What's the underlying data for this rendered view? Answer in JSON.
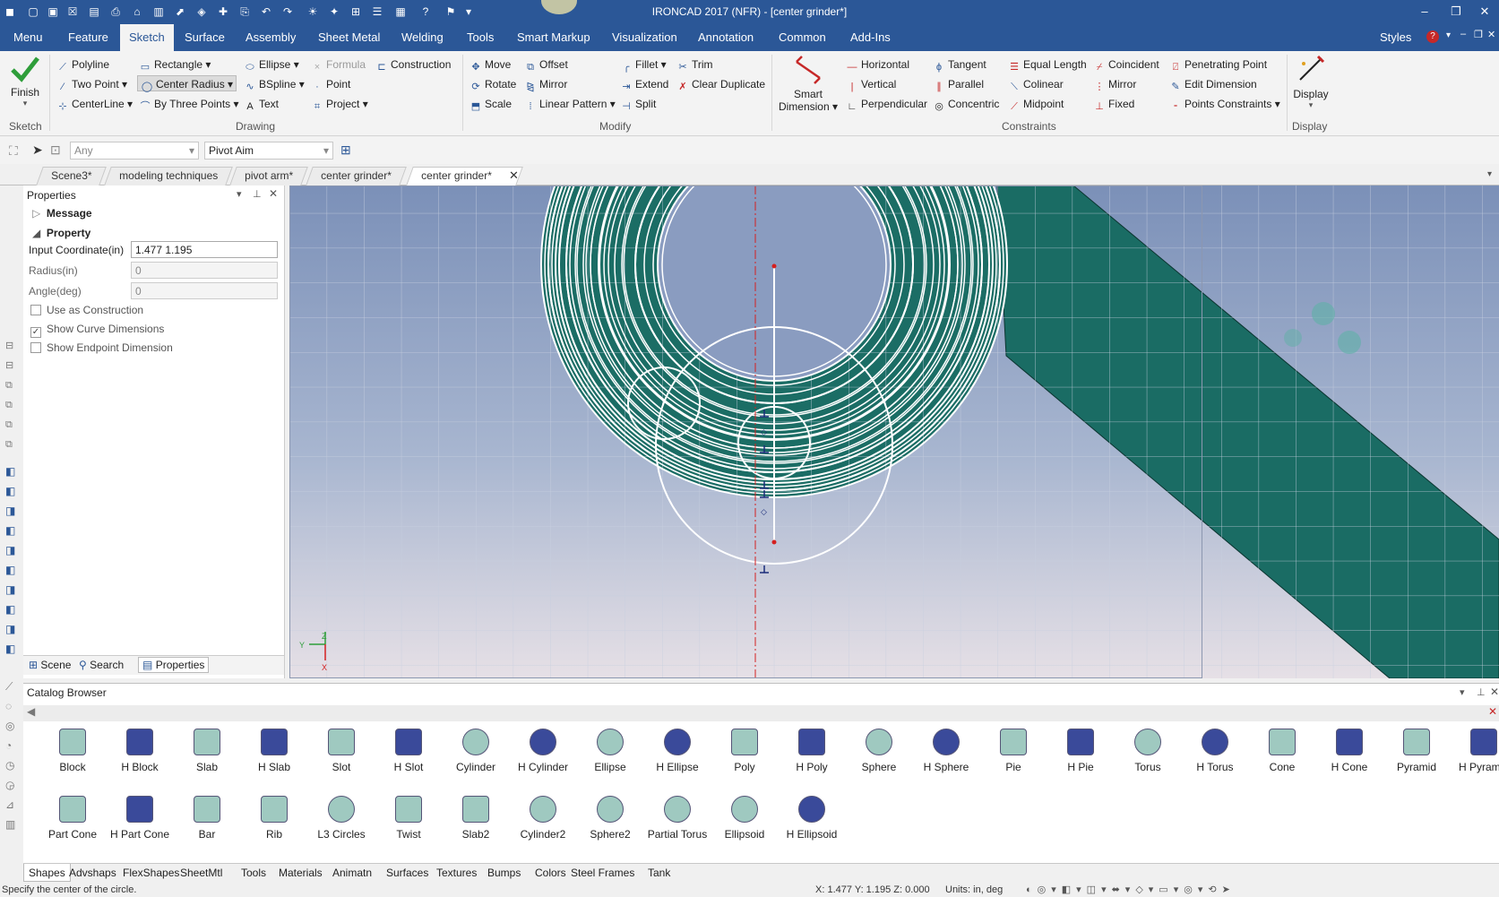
{
  "window": {
    "title": "IRONCAD 2017 (NFR) - [center grinder*]",
    "minimize": "–",
    "restore": "❐",
    "close": "✕"
  },
  "menubar": {
    "items": [
      "Menu",
      "Feature",
      "Sketch",
      "Surface",
      "Assembly",
      "Sheet Metal",
      "Welding",
      "Tools",
      "Smart Markup",
      "Visualization",
      "Annotation",
      "Common",
      "Add-Ins"
    ],
    "active": "Sketch",
    "styles_label": "Styles"
  },
  "ribbon": {
    "sketch": {
      "finish": "Finish",
      "label": "Sketch"
    },
    "drawing": {
      "label": "Drawing",
      "polyline": "Polyline",
      "rectangle": "Rectangle",
      "ellipse": "Ellipse",
      "formula": "Formula",
      "construction": "Construction",
      "two_point": "Two Point",
      "center_radius": "Center Radius",
      "bspline": "BSpline",
      "point": "Point",
      "centerline": "CenterLine",
      "by_three_points": "By Three Points",
      "text": "Text",
      "project": "Project"
    },
    "modify": {
      "label": "Modify",
      "move": "Move",
      "offset": "Offset",
      "fillet": "Fillet",
      "trim": "Trim",
      "rotate": "Rotate",
      "mirror": "Mirror",
      "extend": "Extend",
      "clear_duplicate": "Clear Duplicate",
      "scale": "Scale",
      "linear_pattern": "Linear Pattern",
      "split": "Split"
    },
    "constraints": {
      "label": "Constraints",
      "smart_dimension_1": "Smart",
      "smart_dimension_2": "Dimension",
      "horizontal": "Horizontal",
      "tangent": "Tangent",
      "equal_length": "Equal Length",
      "coincident": "Coincident",
      "penetrating_point": "Penetrating Point",
      "vertical": "Vertical",
      "parallel": "Parallel",
      "colinear": "Colinear",
      "mirror": "Mirror",
      "edit_dimension": "Edit Dimension",
      "perpendicular": "Perpendicular",
      "concentric": "Concentric",
      "midpoint": "Midpoint",
      "fixed": "Fixed",
      "points_constraints": "Points Constraints"
    },
    "display": {
      "button": "Display",
      "label": "Display"
    }
  },
  "toolbar2": {
    "filter_value": "Any",
    "pivot_value": "Pivot Aim"
  },
  "doc_tabs": [
    "Scene3*",
    "modeling techniques",
    "pivot arm*",
    "center grinder*",
    "center grinder*"
  ],
  "properties": {
    "title": "Properties",
    "message": "Message",
    "property": "Property",
    "input_coord_label": "Input Coordinate(in)",
    "input_coord_value": "1.477 1.195",
    "radius_label": "Radius(in)",
    "radius_value": "0",
    "angle_label": "Angle(deg)",
    "angle_value": "0",
    "use_construction": "Use as Construction",
    "show_curve_dims": "Show Curve Dimensions",
    "show_endpoint_dim": "Show Endpoint Dimension",
    "bottom_tabs": [
      "Scene",
      "Search",
      "Properties"
    ]
  },
  "viewport": {
    "axis_z": "Z",
    "axis_y": "Y",
    "axis_x": "X"
  },
  "catalog": {
    "title": "Catalog Browser",
    "row1": [
      "Block",
      "H Block",
      "Slab",
      "H Slab",
      "Slot",
      "H Slot",
      "Cylinder",
      "H Cylinder",
      "Ellipse",
      "H Ellipse",
      "Poly",
      "H Poly",
      "Sphere",
      "H Sphere",
      "Pie",
      "H Pie",
      "Torus",
      "H Torus",
      "Cone",
      "H Cone",
      "Pyramid",
      "H Pyramid"
    ],
    "row2": [
      "Part Cone",
      "H Part Cone",
      "Bar",
      "Rib",
      "L3 Circles",
      "Twist",
      "Slab2",
      "Cylinder2",
      "Sphere2",
      "Partial Torus",
      "Ellipsoid",
      "H Ellipsoid"
    ],
    "tabs": [
      "Shapes",
      "Advshaps",
      "FlexShapes",
      "SheetMtl",
      "Tools",
      "Materials",
      "Animatn",
      "Surfaces",
      "Textures",
      "Bumps",
      "Colors",
      "Steel Frames",
      "Tank"
    ]
  },
  "status": {
    "message": "Specify the center of the circle.",
    "coords": "X: 1.477 Y: 1.195 Z: 0.000",
    "units": "Units: in, deg"
  }
}
